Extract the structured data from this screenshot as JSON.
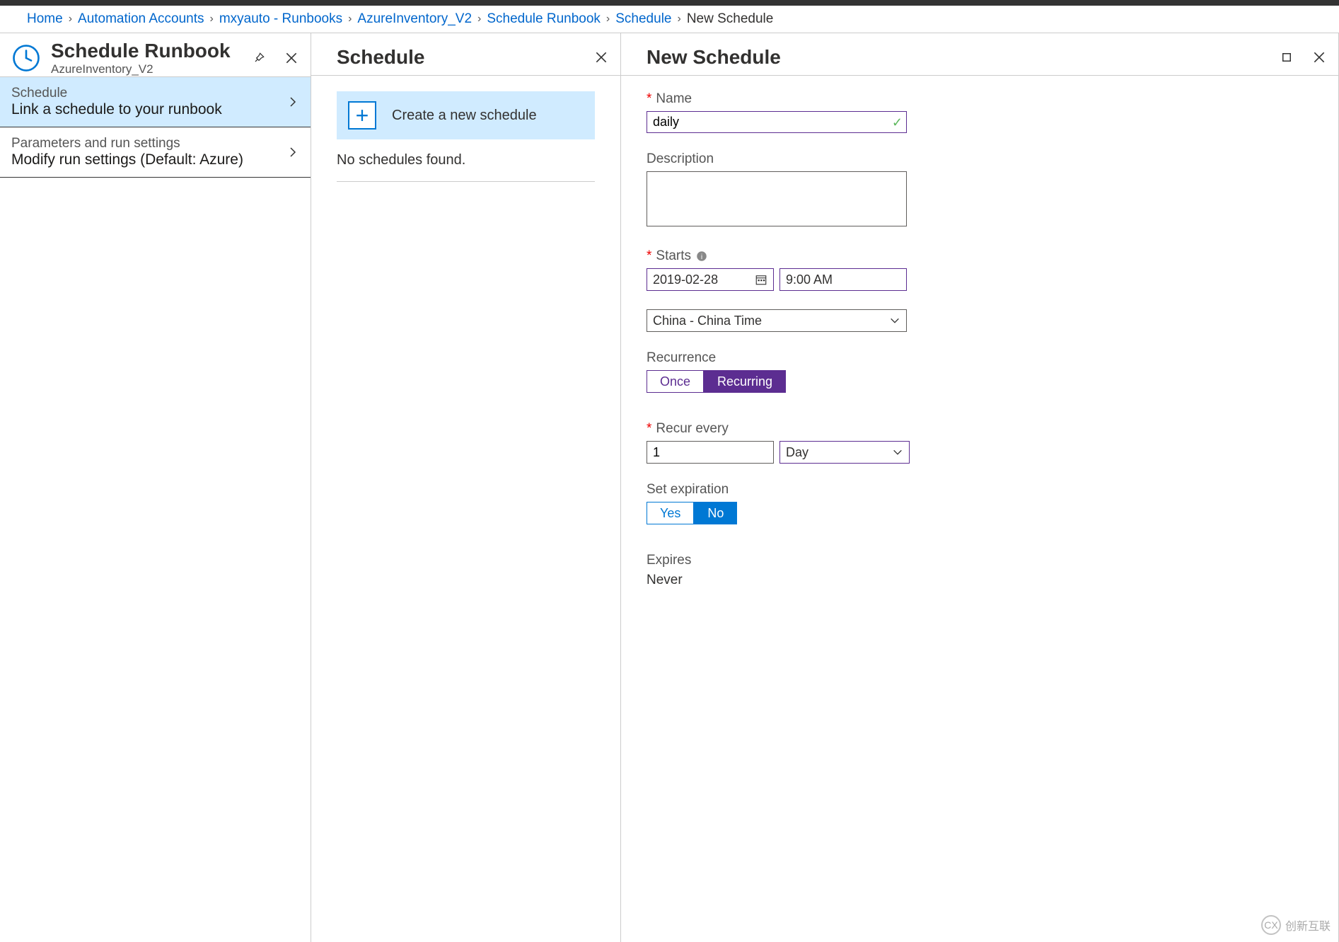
{
  "breadcrumb": [
    {
      "label": "Home",
      "link": true
    },
    {
      "label": "Automation Accounts",
      "link": true
    },
    {
      "label": "mxyauto - Runbooks",
      "link": true
    },
    {
      "label": "AzureInventory_V2",
      "link": true
    },
    {
      "label": "Schedule Runbook",
      "link": true
    },
    {
      "label": "Schedule",
      "link": true
    },
    {
      "label": "New Schedule",
      "link": false
    }
  ],
  "blade1": {
    "title": "Schedule Runbook",
    "subtitle": "AzureInventory_V2",
    "items": [
      {
        "label": "Schedule",
        "desc": "Link a schedule to your runbook",
        "active": true
      },
      {
        "label": "Parameters and run settings",
        "desc": "Modify run settings (Default: Azure)",
        "active": false
      }
    ]
  },
  "blade2": {
    "title": "Schedule",
    "create_label": "Create a new schedule",
    "empty_text": "No schedules found."
  },
  "blade3": {
    "title": "New Schedule",
    "name_label": "Name",
    "name_value": "daily",
    "description_label": "Description",
    "description_value": "",
    "starts_label": "Starts",
    "starts_date": "2019-02-28",
    "starts_time": "9:00 AM",
    "timezone": "China - China Time",
    "recurrence_label": "Recurrence",
    "recurrence_once": "Once",
    "recurrence_recurring": "Recurring",
    "recur_every_label": "Recur every",
    "recur_value": "1",
    "recur_unit": "Day",
    "expiration_label": "Set expiration",
    "expiration_yes": "Yes",
    "expiration_no": "No",
    "expires_label": "Expires",
    "expires_value": "Never"
  },
  "watermark": "创新互联"
}
